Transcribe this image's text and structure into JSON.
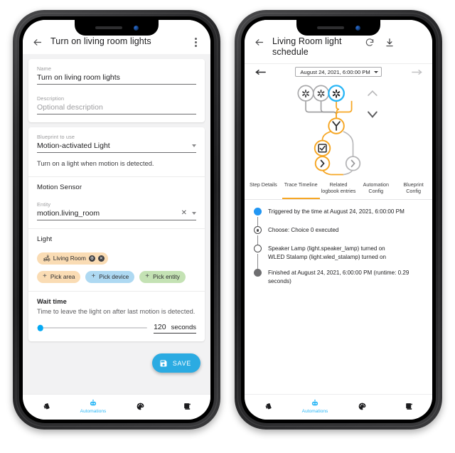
{
  "left_phone": {
    "appbar": {
      "title": "Turn on living room lights",
      "back_icon": "back-arrow-icon",
      "menu_icon": "overflow-menu-icon"
    },
    "name_field": {
      "label": "Name",
      "value": "Turn on living room lights"
    },
    "description_field": {
      "label": "Description",
      "placeholder": "Optional description",
      "value": ""
    },
    "blueprint": {
      "label": "Blueprint to use",
      "value": "Motion-activated Light",
      "description": "Turn on a light when motion is detected."
    },
    "motion_sensor": {
      "title": "Motion Sensor",
      "entity_label": "Entity",
      "entity_value": "motion.living_room",
      "clear_icon": "clear-x-icon",
      "dropdown_icon": "chevron-down-icon"
    },
    "light": {
      "title": "Light",
      "selected_chip": {
        "label": "Living Room",
        "icon": "sofa-icon",
        "settings_icon": "settings-dot-icon",
        "remove_icon": "remove-circle-icon"
      },
      "pick_area": "Pick area",
      "pick_device": "Pick device",
      "pick_entity": "Pick entity"
    },
    "wait_time": {
      "title": "Wait time",
      "description": "Time to leave the light on after last motion is detected.",
      "value": "120",
      "unit": "seconds",
      "slider_percent": 3
    },
    "save_button": {
      "label": "SAVE",
      "icon": "save-disk-icon"
    }
  },
  "right_phone": {
    "appbar": {
      "title": "Living Room light schedule",
      "back_icon": "back-arrow-icon",
      "refresh_icon": "refresh-icon",
      "download_icon": "download-icon"
    },
    "datebar": {
      "prev_icon": "arrow-left-icon",
      "next_icon": "arrow-right-icon",
      "selected": "August 24, 2021, 6:00:00 PM",
      "dropdown_icon": "chevron-down-icon"
    },
    "graph": {
      "collapse_up_icon": "chevron-up-icon",
      "collapse_down_icon": "chevron-down-icon",
      "nodes": [
        {
          "name": "trigger-node-1",
          "icon": "asterisk-icon",
          "state": "inactive"
        },
        {
          "name": "trigger-node-2",
          "icon": "asterisk-icon",
          "state": "inactive"
        },
        {
          "name": "trigger-node-3",
          "icon": "asterisk-icon",
          "state": "selected"
        },
        {
          "name": "choose-branch-node",
          "icon": "fork-icon",
          "state": "active"
        },
        {
          "name": "condition-node",
          "icon": "checkbox-icon",
          "state": "active"
        },
        {
          "name": "action-node-1",
          "icon": "chevron-right-icon",
          "state": "active"
        },
        {
          "name": "action-node-2",
          "icon": "chevron-right-icon",
          "state": "inactive"
        }
      ]
    },
    "tabs": [
      {
        "label": "Step Details",
        "active": false
      },
      {
        "label": "Trace Timeline",
        "active": true
      },
      {
        "label": "Related logbook entries",
        "active": false
      },
      {
        "label": "Automation Config",
        "active": false
      },
      {
        "label": "Blueprint Config",
        "active": false
      }
    ],
    "timeline": [
      {
        "bullet": "filled-blue",
        "lines": [
          "Triggered by the time at August 24, 2021, 6:00:00 PM"
        ]
      },
      {
        "bullet": "ring-dot",
        "lines": [
          "Choose: Choice 0 executed"
        ]
      },
      {
        "bullet": "hollow",
        "lines": [
          "Speaker Lamp (light.speaker_lamp) turned on",
          "WLED Stalamp (light.wled_stalamp) turned on"
        ]
      },
      {
        "bullet": "filled-gray",
        "lines": [
          "Finished at August 24, 2021, 6:00:00 PM (runtime: 0.29",
          "seconds)"
        ]
      }
    ]
  },
  "bottom_nav": {
    "items": [
      {
        "name": "nav-overview",
        "icon": "tilted-panel-icon",
        "label": "",
        "active": false
      },
      {
        "name": "nav-automations",
        "icon": "robot-icon",
        "label": "Automations",
        "active": true
      },
      {
        "name": "nav-themes",
        "icon": "palette-icon",
        "label": "",
        "active": false
      },
      {
        "name": "nav-logbook",
        "icon": "scroll-icon",
        "label": "",
        "active": false
      }
    ]
  },
  "colors": {
    "accent_blue": "#29b6f6",
    "trace_orange": "#f6a623",
    "chip_area": "#fadcb4",
    "chip_device": "#aed9f2",
    "chip_entity": "#c4e2b4",
    "page_bg": "#f2f2f3"
  }
}
